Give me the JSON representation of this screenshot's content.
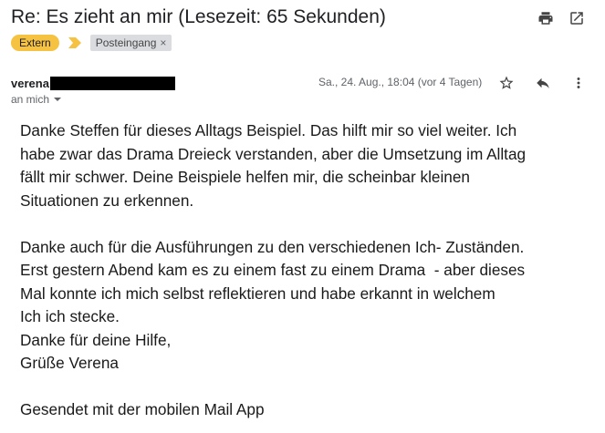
{
  "email": {
    "subject": "Re: Es zieht an mir (Lesezeit: 65 Sekunden)",
    "labels": {
      "extern": "Extern",
      "inbox": "Posteingang",
      "remove_symbol": "×"
    },
    "sender_name": "verena",
    "recipient_line": "an mich",
    "date": "Sa., 24. Aug., 18:04 (vor 4 Tagen)",
    "body": {
      "p1": [
        "Danke Steffen für dieses Alltags Beispiel. Das hilft mir so viel weiter. Ich",
        "habe zwar das Drama Dreieck verstanden, aber die Umsetzung im Alltag",
        "fällt mir schwer. Deine Beispiele helfen mir, die scheinbar kleinen",
        "Situationen zu erkennen."
      ],
      "p2": [
        "Danke auch für die Ausführungen zu den verschiedenen Ich- Zuständen.",
        "Erst gestern Abend kam es zu einem fast zu einem Drama  - aber dieses",
        "Mal konnte ich mich selbst reflektieren und habe erkannt in welchem",
        "Ich ich stecke.",
        "Danke für deine Hilfe,",
        "Grüße Verena"
      ],
      "signature": "Gesendet mit der mobilen Mail App"
    }
  },
  "icons": {
    "print": "print-icon",
    "open_new_window": "open-in-new-window-icon",
    "star": "star-icon",
    "reply": "reply-icon",
    "more": "more-vert-icon",
    "label_arrow": "importance-marker-icon",
    "dropdown": "chevron-down-icon"
  },
  "colors": {
    "extern_label": "#f5c242",
    "inbox_label": "#dadce0",
    "redaction": "#000000"
  }
}
